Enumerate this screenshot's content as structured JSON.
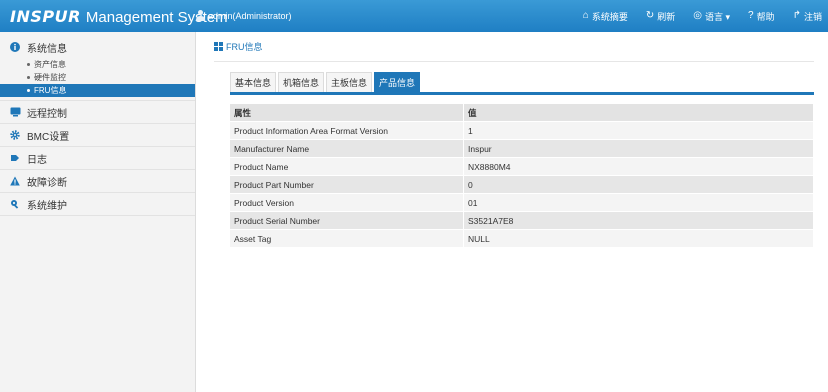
{
  "header": {
    "logo": "INSPUR",
    "title": "Management System",
    "user": "admin(Administrator)",
    "links": [
      {
        "icon": "home-icon",
        "glyph": "⌂",
        "label": "系统摘要"
      },
      {
        "icon": "refresh-icon",
        "glyph": "↻",
        "label": "刷新"
      },
      {
        "icon": "language-icon",
        "glyph": "◎",
        "label": "语言 ▾"
      },
      {
        "icon": "help-icon",
        "glyph": "?",
        "label": "帮助"
      },
      {
        "icon": "logout-icon",
        "glyph": "↱",
        "label": "注销"
      }
    ]
  },
  "sidebar": {
    "system_info": "系统信息",
    "sub_items": [
      "资产信息",
      "硬件监控",
      "FRU信息"
    ],
    "items": [
      "远程控制",
      "BMC设置",
      "日志",
      "故障诊断",
      "系统维护"
    ]
  },
  "main": {
    "section_title": "FRU信息",
    "tabs": [
      "基本信息",
      "机箱信息",
      "主板信息",
      "产品信息"
    ],
    "active_tab": "产品信息",
    "table": {
      "headers": [
        "属性",
        "值"
      ],
      "rows": [
        [
          "Product Information Area Format Version",
          "1"
        ],
        [
          "Manufacturer Name",
          "Inspur"
        ],
        [
          "Product Name",
          "NX8880M4"
        ],
        [
          "Product Part Number",
          "0"
        ],
        [
          "Product Version",
          "01"
        ],
        [
          "Product Serial Number",
          "S3521A7E8"
        ],
        [
          "Asset Tag",
          "NULL"
        ]
      ]
    }
  },
  "colors": {
    "header": "#2a8ccd",
    "accent": "#1f77b8",
    "sidebar_bg": "#f3f3f3"
  }
}
